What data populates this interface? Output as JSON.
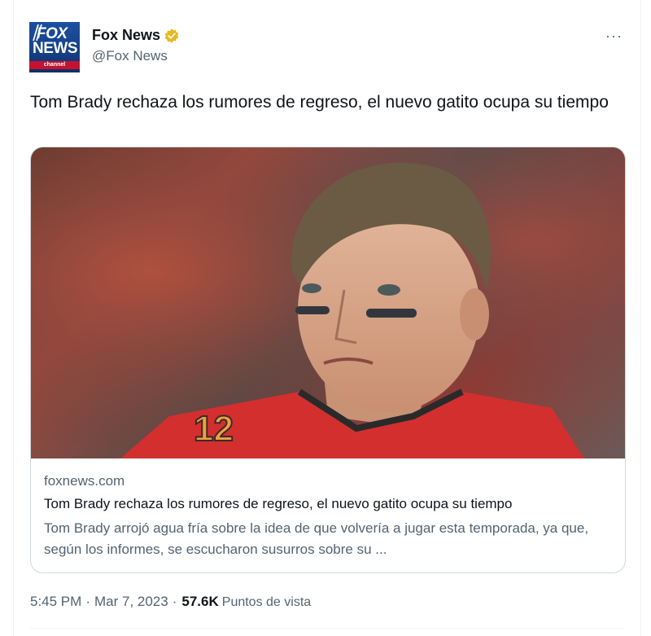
{
  "author": {
    "display_name": "Fox News",
    "handle": "@Fox News",
    "avatar": {
      "line1": "FOX",
      "line2": "NEWS",
      "line3": "channel"
    },
    "verified_icon": "verified-badge-icon",
    "verified_color": "#e8b923"
  },
  "menu": {
    "more_label": "···"
  },
  "tweet": {
    "text": "Tom Brady rechaza los rumores de regreso, el nuevo gatito ocupa su tiempo"
  },
  "card": {
    "domain": "foxnews.com",
    "title": "Tom Brady rechaza los rumores de regreso, el nuevo gatito ocupa su tiempo",
    "description": "Tom Brady arrojó agua fría sobre la idea de que volvería a jugar esta temporada, ya que, según los informes, se escucharon susurros sobre su ...",
    "image_icon": "player-photo"
  },
  "meta": {
    "time": "5:45 PM",
    "separator1": "·",
    "date": "Mar 7, 2023",
    "separator2": "·",
    "views_count": "57.6K",
    "views_label": "Puntos de vista"
  },
  "colors": {
    "text_primary": "#0f1419",
    "text_secondary": "#536471",
    "border": "#cfd9de",
    "jersey_red": "#d32f2f"
  }
}
